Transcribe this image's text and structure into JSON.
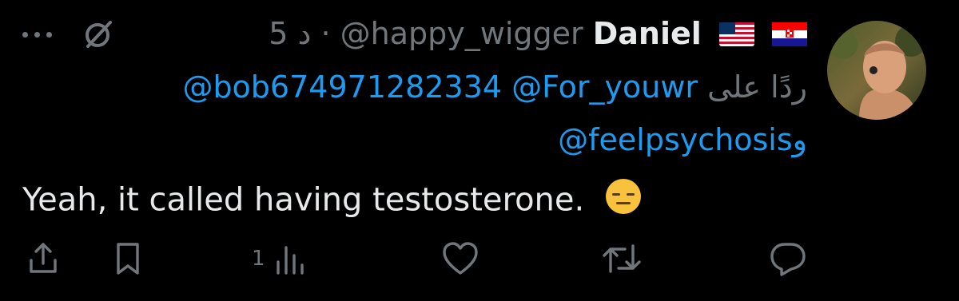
{
  "header": {
    "time": "5 د",
    "separator": "·",
    "handle": "@happy_wigger",
    "display_name": "Daniel",
    "flags": [
      "us-flag-icon",
      "croatia-flag-icon"
    ]
  },
  "reply": {
    "prefix": "ردًا على",
    "mention_1": "@For_youwr",
    "mention_2": "@bob674971282334",
    "conjunction": "و",
    "mention_3": "@feelpsychosis"
  },
  "tweet": {
    "text": "Yeah, it called having testosterone.",
    "emoji": "expressionless-face-emoji"
  },
  "actions": {
    "views_count": "1",
    "icons": [
      "share-icon",
      "bookmark-icon",
      "views-icon",
      "like-icon",
      "retweet-icon",
      "reply-icon"
    ]
  },
  "colors": {
    "background": "#000000",
    "text": "#e7e9ea",
    "muted": "#71767b",
    "link": "#1d9bf0"
  }
}
